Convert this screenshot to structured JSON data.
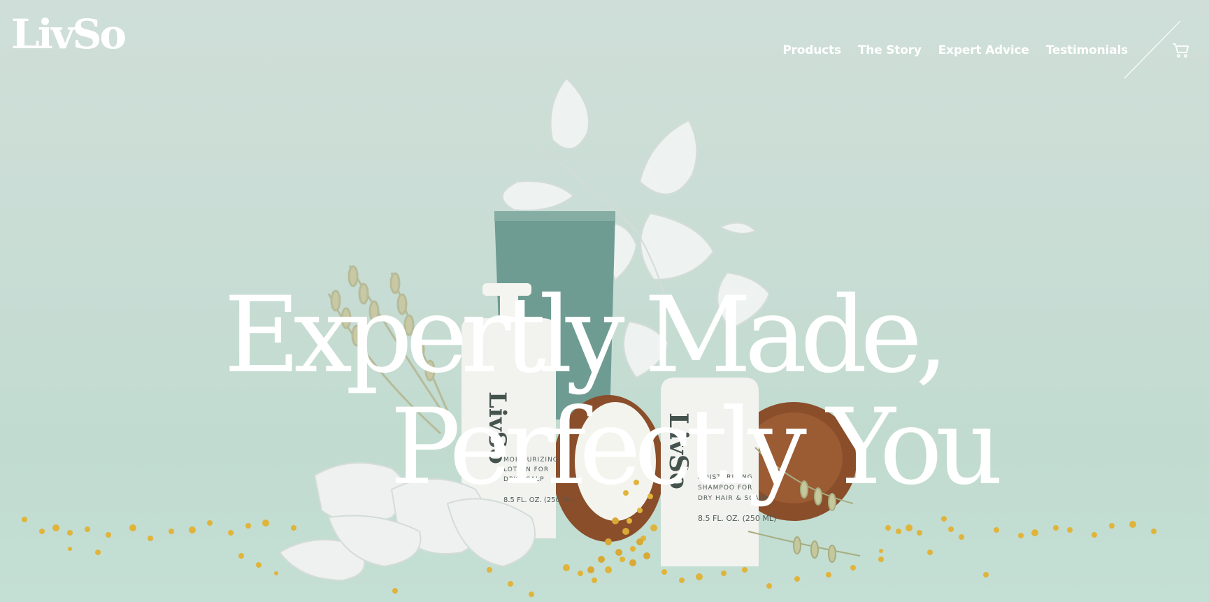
{
  "header": {
    "logo": "LivSo",
    "nav": [
      "Products",
      "The Story",
      "Expert Advice",
      "Testimonials"
    ]
  },
  "hero": {
    "headline_line1": "Expertly Made,",
    "headline_line2": "Perfectly You"
  },
  "product_labels": {
    "lotion_brand": "LivSo",
    "lotion_text": [
      "MOISTURIZING",
      "LOTION FOR",
      "DRY SCALP",
      "8.5 FL. OZ. (250 ML)"
    ],
    "shampoo_brand": "LivSo",
    "shampoo_text": [
      "MOISTURIZING",
      "SHAMPOO FOR",
      "DRY HAIR & SCALP",
      "8.5 FL. OZ. (250 ML)"
    ]
  },
  "icons": {
    "cart": "cart-icon"
  },
  "colors": {
    "background": "#c9ddd5",
    "text": "#ffffff",
    "tube": "#6e9c92",
    "coconut": "#8a4e2a",
    "flowers": "#e0b43a"
  }
}
